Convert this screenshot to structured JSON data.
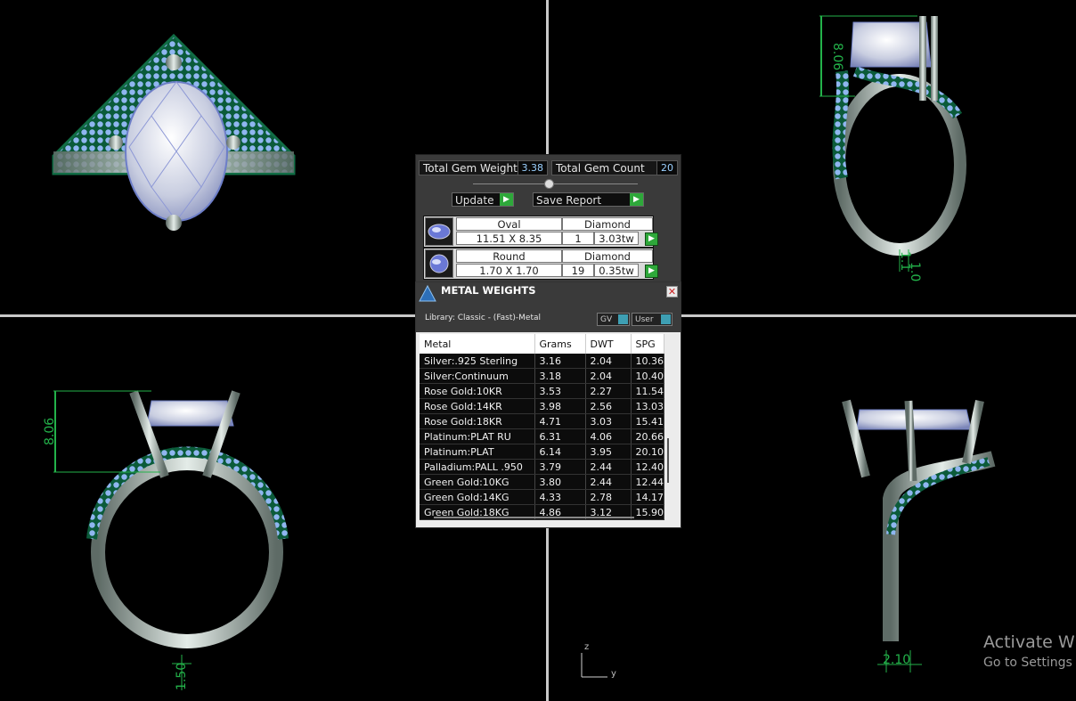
{
  "dimensions": {
    "front_height": "8.06",
    "side_height": "8.06",
    "bottom_width": "1.50",
    "side_width": "2.10",
    "small1": "1.1",
    "small2": "1.0"
  },
  "axis": {
    "z": "z",
    "y": "y"
  },
  "gem_panel": {
    "total_weight_label": "Total Gem Weight",
    "total_weight_value": "3.38",
    "total_count_label": "Total Gem Count",
    "total_count_value": "20",
    "update_label": "Update",
    "save_label": "Save Report",
    "gems": [
      {
        "shape": "Oval",
        "material": "Diamond",
        "size": "11.51 X 8.35",
        "count": "1",
        "weight": "3.03tw"
      },
      {
        "shape": "Round",
        "material": "Diamond",
        "size": "1.70 X 1.70",
        "count": "19",
        "weight": "0.35tw"
      }
    ]
  },
  "metal_weights": {
    "title": "METAL WEIGHTS",
    "library": "Library: Classic - (Fast)-Metal",
    "toggle_gv": "GV",
    "toggle_user": "User",
    "columns": [
      "Metal",
      "Grams",
      "DWT",
      "SPG"
    ],
    "rows": [
      [
        "Silver:.925 Sterling",
        "3.16",
        "2.04",
        "10.36"
      ],
      [
        "Silver:Continuum",
        "3.18",
        "2.04",
        "10.40"
      ],
      [
        "Rose Gold:10KR",
        "3.53",
        "2.27",
        "11.54"
      ],
      [
        "Rose Gold:14KR",
        "3.98",
        "2.56",
        "13.03"
      ],
      [
        "Rose Gold:18KR",
        "4.71",
        "3.03",
        "15.41"
      ],
      [
        "Platinum:PLAT RU",
        "6.31",
        "4.06",
        "20.66"
      ],
      [
        "Platinum:PLAT",
        "6.14",
        "3.95",
        "20.10"
      ],
      [
        "Palladium:PALL .950",
        "3.79",
        "2.44",
        "12.40"
      ],
      [
        "Green Gold:10KG",
        "3.80",
        "2.44",
        "12.44"
      ],
      [
        "Green Gold:14KG",
        "4.33",
        "2.78",
        "14.17"
      ],
      [
        "Green Gold:18KG",
        "4.86",
        "3.12",
        "15.90"
      ]
    ]
  },
  "watermark": {
    "line1": "Activate Wir",
    "line2": "Go to Settings t"
  },
  "colors": {
    "accent_green": "#23b24a",
    "go_button": "#2ea83a",
    "value_blue": "#9ad0ff"
  }
}
